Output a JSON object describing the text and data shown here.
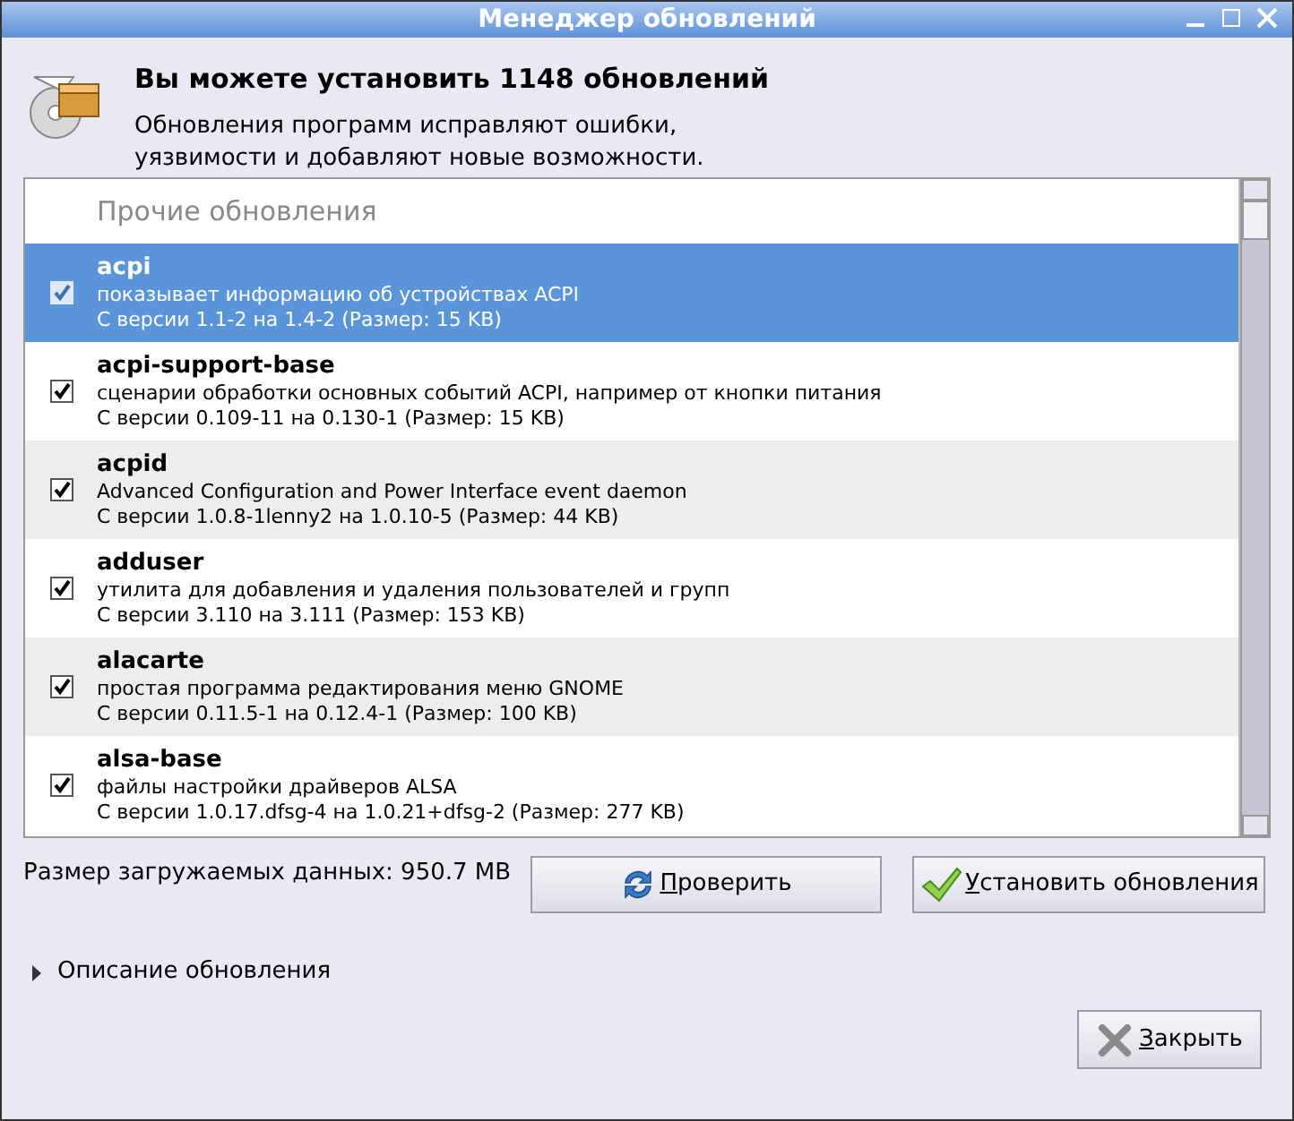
{
  "window": {
    "title": "Менеджер обновлений"
  },
  "header": {
    "title": "Вы можете установить 1148 обновлений",
    "description": "Обновления программ исправляют ошибки,\nуязвимости и добавляют новые возможности."
  },
  "list": {
    "section": "Прочие обновления",
    "rows": [
      {
        "name": "acpi",
        "description": "показывает информацию об устройствах ACPI",
        "version": "С версии 1.1-2 на 1.4-2 (Размер: 15 KB)",
        "checked": true,
        "selected": true
      },
      {
        "name": "acpi-support-base",
        "description": "сценарии обработки основных событий ACPI, например от кнопки питания",
        "version": "С версии 0.109-11 на 0.130-1 (Размер: 15 KB)",
        "checked": true,
        "selected": false
      },
      {
        "name": "acpid",
        "description": "Advanced Configuration and Power Interface event daemon",
        "version": "С версии 1.0.8-1lenny2 на 1.0.10-5 (Размер: 44 KB)",
        "checked": true,
        "selected": false
      },
      {
        "name": "adduser",
        "description": "утилита для добавления и удаления пользователей и групп",
        "version": "С версии 3.110 на 3.111 (Размер: 153 KB)",
        "checked": true,
        "selected": false
      },
      {
        "name": "alacarte",
        "description": "простая программа редактирования меню GNOME",
        "version": "С версии 0.11.5-1 на 0.12.4-1 (Размер: 100 KB)",
        "checked": true,
        "selected": false
      },
      {
        "name": "alsa-base",
        "description": "файлы настройки драйверов ALSA",
        "version": "С версии 1.0.17.dfsg-4 на 1.0.21+dfsg-2 (Размер: 277 KB)",
        "checked": true,
        "selected": false
      }
    ]
  },
  "download_size": "Размер загружаемых данных: 950.7 MB",
  "buttons": [
    {
      "kind": "refresh",
      "label": "Проверить"
    },
    {
      "kind": "install",
      "label": "Установить обновления"
    }
  ],
  "expander": {
    "label": "Описание обновления",
    "expanded": false
  },
  "close_button": {
    "label": "Закрыть"
  }
}
